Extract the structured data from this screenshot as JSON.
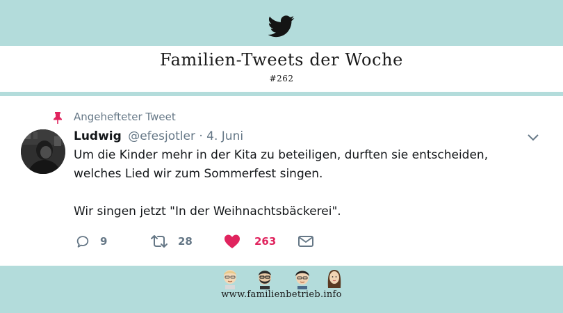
{
  "header": {
    "logo_icon": "twitter-bird-icon",
    "title": "Familien-Tweets der Woche",
    "subtitle": "#262"
  },
  "tweet": {
    "pinned_label": "Angehefteter Tweet",
    "author_name": "Ludwig",
    "author_handle": "@efesjotler",
    "date": "· 4. Juni",
    "text_line1": "Um die Kinder mehr in der Kita zu beteiligen, durften sie entscheiden, welches Lied wir zum Sommerfest singen.",
    "text_line2": "Wir singen jetzt \"In der Weihnachtsbäckerei\".",
    "replies": "9",
    "retweets": "28",
    "likes": "263"
  },
  "footer": {
    "url": "www.familienbetrieb.info"
  },
  "colors": {
    "band": "#b3dcdb",
    "twitter_blue": "#1da1f2",
    "like_pink": "#e0245e",
    "meta_gray": "#657786",
    "text_dark": "#14171a"
  }
}
